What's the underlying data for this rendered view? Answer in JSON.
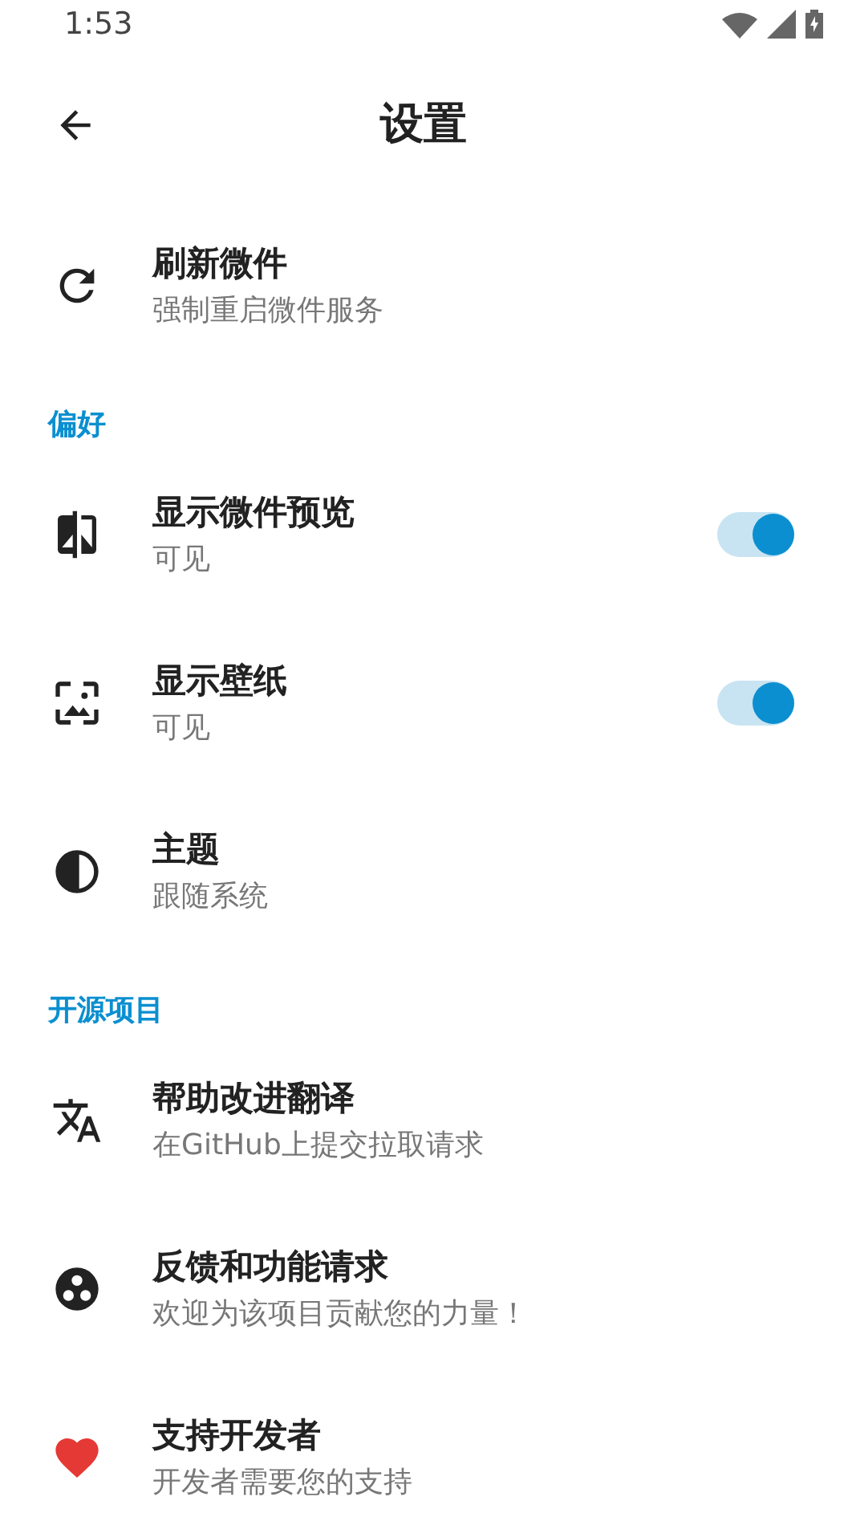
{
  "status_bar": {
    "time": "1:53"
  },
  "toolbar": {
    "title": "设置"
  },
  "sections": [
    {
      "items": [
        {
          "kind": "action",
          "title": "刷新微件",
          "subtitle": "强制重启微件服务"
        }
      ]
    },
    {
      "header": "偏好",
      "items": [
        {
          "kind": "switch",
          "title": "显示微件预览",
          "subtitle": "可见",
          "on": true
        },
        {
          "kind": "switch",
          "title": "显示壁纸",
          "subtitle": "可见",
          "on": true
        },
        {
          "kind": "action",
          "title": "主题",
          "subtitle": "跟随系统"
        }
      ]
    },
    {
      "header": "开源项目",
      "items": [
        {
          "kind": "action",
          "title": "帮助改进翻译",
          "subtitle": "在GitHub上提交拉取请求"
        },
        {
          "kind": "action",
          "title": "反馈和功能请求",
          "subtitle": "欢迎为该项目贡献您的力量！"
        },
        {
          "kind": "action",
          "title": "支持开发者",
          "subtitle": "开发者需要您的支持"
        }
      ]
    }
  ]
}
